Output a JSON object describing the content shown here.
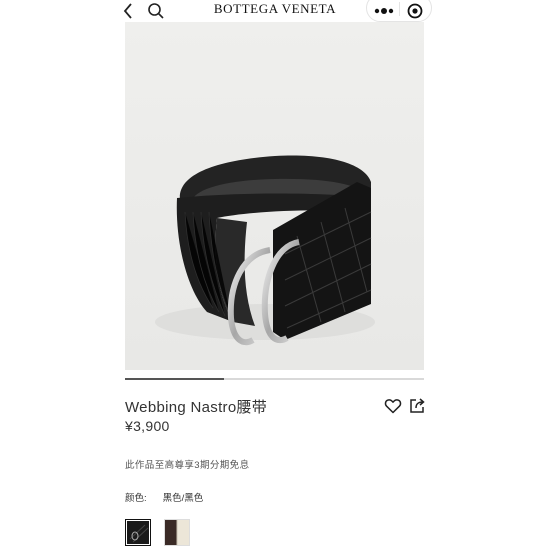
{
  "header": {
    "brand": "BOTTEGA VENETA",
    "icons": {
      "back": "chevron-left-icon",
      "search": "search-icon",
      "more": "more-dots-icon",
      "target": "target-icon"
    }
  },
  "gallery": {
    "progress": 0.33
  },
  "product": {
    "name": "Webbing Nastro腰带",
    "price": "¥3,900",
    "installment_note": "此作品至高尊享3期分期免息",
    "color_label": "颜色:",
    "color_value": "黑色/黑色",
    "swatches": [
      {
        "name": "black",
        "selected": true,
        "color": "#1a1a1a"
      },
      {
        "name": "brown-cream",
        "selected": false,
        "colors": [
          "#3a2a26",
          "#ece6d8"
        ]
      }
    ]
  },
  "colors": {
    "accent": "#333333",
    "background": "#ffffff",
    "image_bg": "#ededeb"
  }
}
